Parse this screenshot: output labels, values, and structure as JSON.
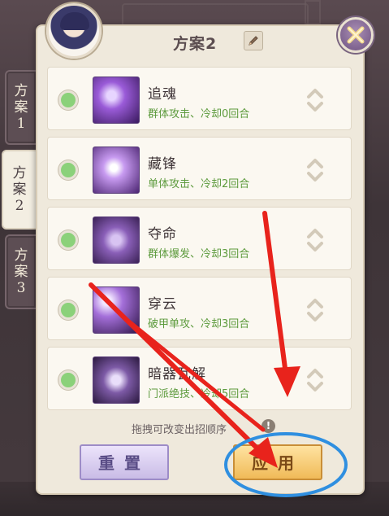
{
  "panel": {
    "title": "方案2"
  },
  "side_tabs": [
    {
      "label": "方\n案\n1",
      "line1": "方",
      "line2": "案",
      "line3": "1",
      "active": false
    },
    {
      "label": "方\n案\n2",
      "line1": "方",
      "line2": "案",
      "line3": "2",
      "active": true
    },
    {
      "label": "方\n案\n3",
      "line1": "方",
      "line2": "案",
      "line3": "3",
      "active": false
    }
  ],
  "skills": [
    {
      "name": "追魂",
      "desc": "群体攻击、冷却0回合"
    },
    {
      "name": "藏锋",
      "desc": "单体攻击、冷却2回合"
    },
    {
      "name": "夺命",
      "desc": "群体爆发、冷却3回合"
    },
    {
      "name": "穿云",
      "desc": "破甲单攻、冷却3回合"
    },
    {
      "name": "暗器瓦解",
      "desc": "门派绝技、冷却5回合"
    }
  ],
  "hint": "拖拽可改变出招顺序",
  "buttons": {
    "reset": "重置",
    "apply": "应用"
  },
  "icons": {
    "edit": "edit-icon",
    "close": "close-icon",
    "drag": "drag-handle-icon",
    "info": "info-icon",
    "radio": "radio-selected-icon"
  },
  "colors": {
    "panel_bg": "#efe9dc",
    "skill_desc": "#5c9a3c",
    "radio": "#8bd17a",
    "apply_button": "#f0ba58",
    "reset_button": "#c9bce6",
    "annotation_arrow": "#e8231c",
    "annotation_circle": "#2f8fe0"
  }
}
